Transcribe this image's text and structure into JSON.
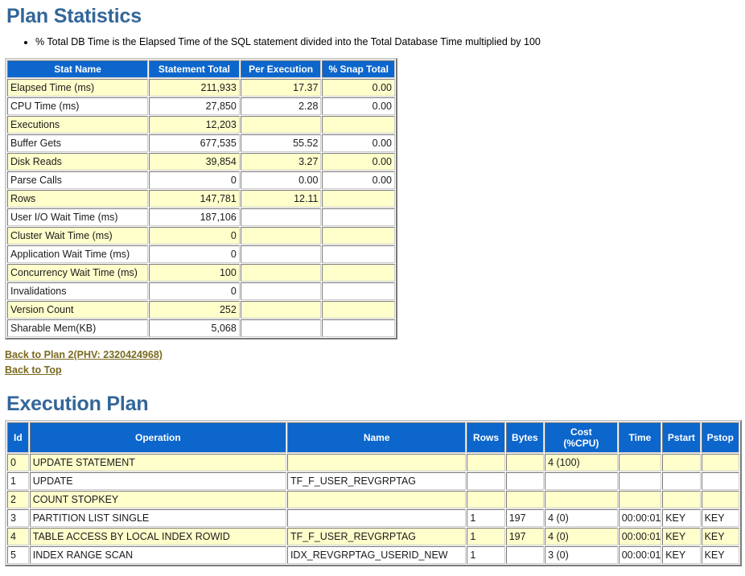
{
  "plan_statistics": {
    "title": "Plan Statistics",
    "notes": [
      "% Total DB Time is the Elapsed Time of the SQL statement divided into the Total Database Time multiplied by 100"
    ],
    "columns": [
      "Stat Name",
      "Statement Total",
      "Per Execution",
      "% Snap Total"
    ],
    "rows": [
      {
        "stat": "Elapsed Time (ms)",
        "total": "211,933",
        "per_exec": "17.37",
        "snap_pct": "0.00"
      },
      {
        "stat": "CPU Time (ms)",
        "total": "27,850",
        "per_exec": "2.28",
        "snap_pct": "0.00"
      },
      {
        "stat": "Executions",
        "total": "12,203",
        "per_exec": "",
        "snap_pct": ""
      },
      {
        "stat": "Buffer Gets",
        "total": "677,535",
        "per_exec": "55.52",
        "snap_pct": "0.00"
      },
      {
        "stat": "Disk Reads",
        "total": "39,854",
        "per_exec": "3.27",
        "snap_pct": "0.00"
      },
      {
        "stat": "Parse Calls",
        "total": "0",
        "per_exec": "0.00",
        "snap_pct": "0.00"
      },
      {
        "stat": "Rows",
        "total": "147,781",
        "per_exec": "12.11",
        "snap_pct": ""
      },
      {
        "stat": "User I/O Wait Time (ms)",
        "total": "187,106",
        "per_exec": "",
        "snap_pct": ""
      },
      {
        "stat": "Cluster Wait Time (ms)",
        "total": "0",
        "per_exec": "",
        "snap_pct": ""
      },
      {
        "stat": "Application Wait Time (ms)",
        "total": "0",
        "per_exec": "",
        "snap_pct": ""
      },
      {
        "stat": "Concurrency Wait Time (ms)",
        "total": "100",
        "per_exec": "",
        "snap_pct": ""
      },
      {
        "stat": "Invalidations",
        "total": "0",
        "per_exec": "",
        "snap_pct": ""
      },
      {
        "stat": "Version Count",
        "total": "252",
        "per_exec": "",
        "snap_pct": ""
      },
      {
        "stat": "Sharable Mem(KB)",
        "total": "5,068",
        "per_exec": "",
        "snap_pct": ""
      }
    ]
  },
  "links": [
    {
      "label": "Back to Plan 2(PHV: 2320424968)"
    },
    {
      "label": "Back to Top"
    }
  ],
  "execution_plan": {
    "title": "Execution Plan",
    "columns": [
      "Id",
      "Operation",
      "Name",
      "Rows",
      "Bytes",
      "Cost (%CPU)",
      "Time",
      "Pstart",
      "Pstop"
    ],
    "column_cost_line1": "Cost",
    "column_cost_line2": "(%CPU)",
    "rows": [
      {
        "id": "0",
        "indent": 0,
        "operation": "UPDATE STATEMENT",
        "name": "",
        "rows": "",
        "bytes": "",
        "cost": "4 (100)",
        "time": "",
        "pstart": "",
        "pstop": ""
      },
      {
        "id": "1",
        "indent": 1,
        "operation": "UPDATE",
        "name": "TF_F_USER_REVGRPTAG",
        "rows": "",
        "bytes": "",
        "cost": "",
        "time": "",
        "pstart": "",
        "pstop": ""
      },
      {
        "id": "2",
        "indent": 2,
        "operation": "COUNT STOPKEY",
        "name": "",
        "rows": "",
        "bytes": "",
        "cost": "",
        "time": "",
        "pstart": "",
        "pstop": ""
      },
      {
        "id": "3",
        "indent": 3,
        "operation": "PARTITION LIST SINGLE",
        "name": "",
        "rows": "1",
        "bytes": "197",
        "cost": "4 (0)",
        "time": "00:00:01",
        "pstart": "KEY",
        "pstop": "KEY"
      },
      {
        "id": "4",
        "indent": 4,
        "operation": "TABLE ACCESS BY LOCAL INDEX ROWID",
        "name": "TF_F_USER_REVGRPTAG",
        "rows": "1",
        "bytes": "197",
        "cost": "4 (0)",
        "time": "00:00:01",
        "pstart": "KEY",
        "pstop": "KEY"
      },
      {
        "id": "5",
        "indent": 5,
        "operation": "INDEX RANGE SCAN",
        "name": "IDX_REVGRPTAG_USERID_NEW",
        "rows": "1",
        "bytes": "",
        "cost": "3 (0)",
        "time": "00:00:01",
        "pstart": "KEY",
        "pstop": "KEY"
      }
    ]
  },
  "colors": {
    "header_blue": "#0c66cc",
    "row_yellow": "#ffffcc",
    "row_white": "#ffffff",
    "heading_blue": "#336699",
    "link_olive": "#7a6a20"
  }
}
